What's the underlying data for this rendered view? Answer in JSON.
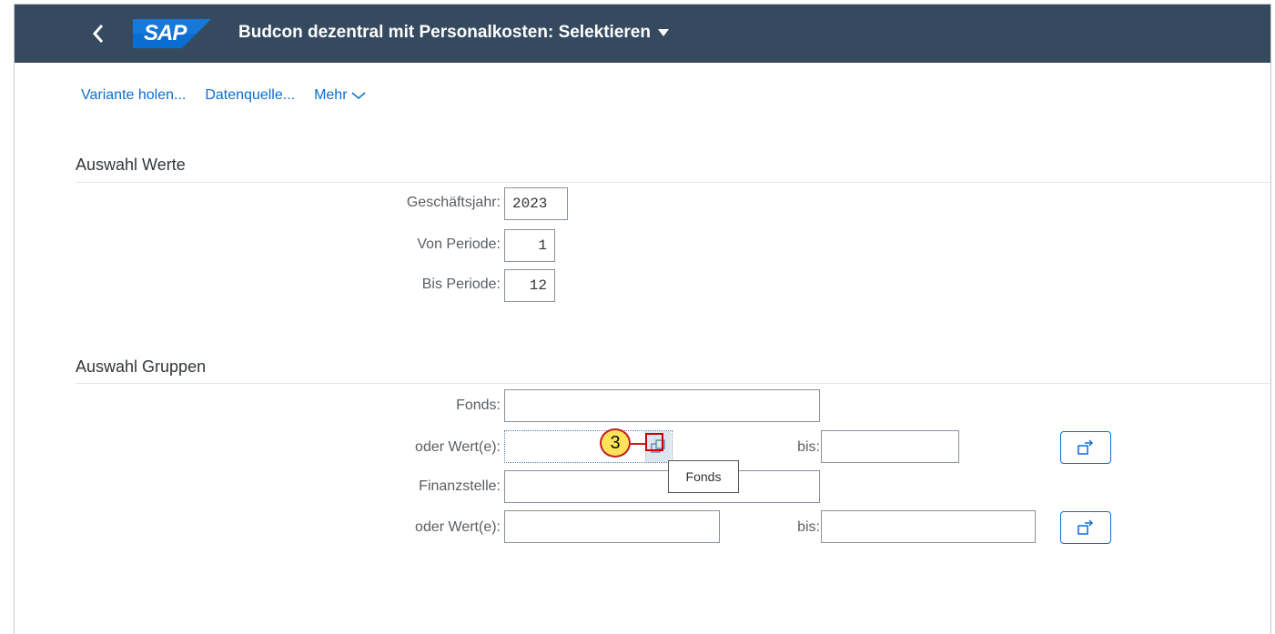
{
  "header": {
    "title": "Budcon dezentral mit Personalkosten: Selektieren",
    "logo_text": "SAP",
    "colors": {
      "shell": "#354a5f",
      "accent": "#0a6ed1",
      "logo": "#0a6ed1"
    }
  },
  "toolbar": {
    "variant": "Variante holen...",
    "datasource": "Datenquelle...",
    "more": "Mehr"
  },
  "group_values": {
    "title": "Auswahl Werte",
    "fiscal_year_label": "Geschäftsjahr:",
    "fiscal_year_value": "2023",
    "from_period_label": "Von Periode:",
    "from_period_value": "1",
    "to_period_label": "Bis Periode:",
    "to_period_value": "12"
  },
  "group_groups": {
    "title": "Auswahl Gruppen",
    "fonds_label": "Fonds:",
    "fonds_value": "",
    "fonds_or_label": "oder Wert(e):",
    "fonds_from_value": "",
    "fonds_to_label": "bis:",
    "fonds_to_value": "",
    "finanzstelle_label": "Finanzstelle:",
    "finanzstelle_value": "",
    "finanzstelle_or_label": "oder Wert(e):",
    "finanzstelle_from_value": "",
    "finanzstelle_to_label": "bis:",
    "finanzstelle_to_value": ""
  },
  "tooltip": {
    "text": "Fonds"
  },
  "callout": {
    "number": "3"
  },
  "icons": [
    "back-icon",
    "sap-logo",
    "dropdown-icon",
    "chevron-down-icon",
    "value-help-icon",
    "multiple-selection-icon"
  ]
}
